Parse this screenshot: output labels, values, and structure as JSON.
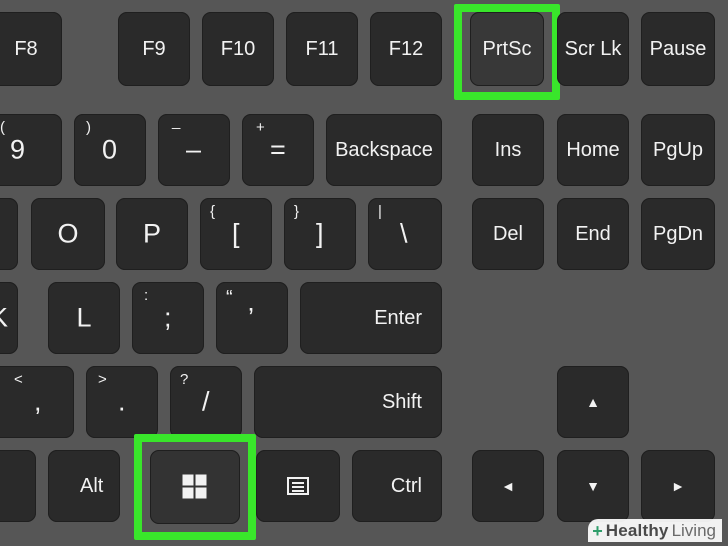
{
  "colors": {
    "background": "#565656",
    "key": "#2a2a2a",
    "highlight": "#39e62b",
    "text": "#f2f2f2"
  },
  "keys": {
    "f8": "F8",
    "f9": "F9",
    "f10": "F10",
    "f11": "F11",
    "f12": "F12",
    "prtsc": "PrtSc",
    "scrlk": "Scr Lk",
    "pause": "Pause",
    "nine_top": "(",
    "nine": "9",
    "zero_top": ")",
    "zero": "0",
    "minus_top": "_",
    "minus": "–",
    "equals_top": "+",
    "equals": "=",
    "backspace": "Backspace",
    "ins": "Ins",
    "home": "Home",
    "pgup": "PgUp",
    "o": "O",
    "p": "P",
    "lbracket_top": "{",
    "lbracket": "[",
    "rbracket_top": "}",
    "rbracket": "]",
    "backslash_top": "|",
    "backslash": "\\",
    "del": "Del",
    "end": "End",
    "pgdn": "PgDn",
    "k": "K",
    "l": "L",
    "semicolon_top": ":",
    "semicolon": ";",
    "quote_top": "“",
    "quote": "’",
    "enter": "Enter",
    "comma_top": "<",
    "comma": ",",
    "period_top": ">",
    "period": ".",
    "slash_top": "?",
    "slash": "/",
    "shift": "Shift",
    "up": "▲",
    "alt": "Alt",
    "ctrl": "Ctrl",
    "left": "◄",
    "down": "▼",
    "right": "►"
  },
  "icons": {
    "windows": "windows-logo-icon",
    "menu": "context-menu-icon"
  },
  "brand": {
    "prefix": "+",
    "name": "Healthy",
    "suffix": " Living"
  }
}
